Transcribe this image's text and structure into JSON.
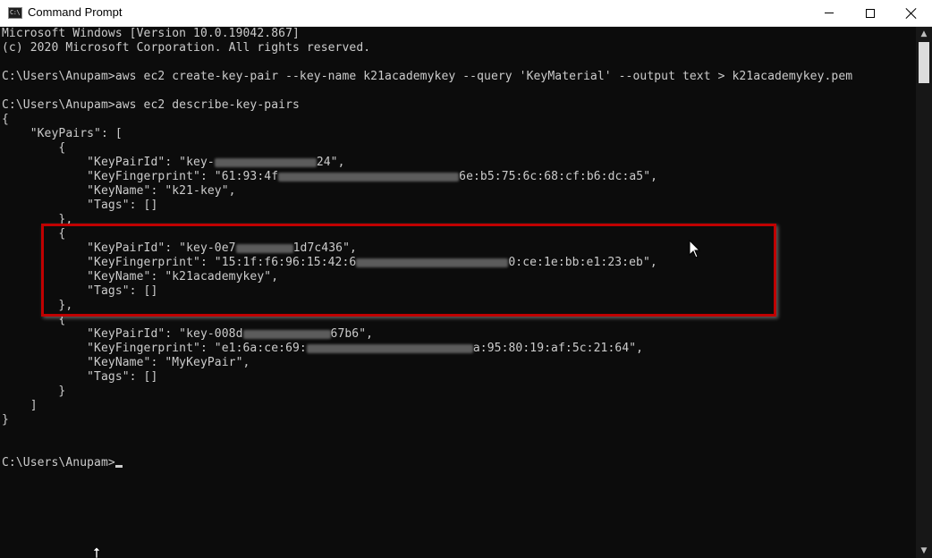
{
  "window": {
    "title": "Command Prompt",
    "icon_label": "C:\\",
    "controls": {
      "minimize": "minimize-icon",
      "maximize": "maximize-icon",
      "close": "close-icon"
    }
  },
  "console": {
    "lines": [
      "Microsoft Windows [Version 10.0.19042.867]",
      "(c) 2020 Microsoft Corporation. All rights reserved.",
      "",
      "C:\\Users\\Anupam>aws ec2 create-key-pair --key-name k21academykey --query 'KeyMaterial' --output text > k21academykey.pem",
      "",
      "C:\\Users\\Anupam>aws ec2 describe-key-pairs",
      "{",
      "    \"KeyPairs\": [",
      "        {",
      "            \"KeyPairId\": \"key-",
      "            \"KeyFingerprint\": \"61:93:4f",
      "            \"KeyName\": \"k21-key\",",
      "            \"Tags\": []",
      "        },",
      "        {",
      "            \"KeyPairId\": \"key-0e7",
      "            \"KeyFingerprint\": \"15:1f:f6:96:15:42:6",
      "            \"KeyName\": \"k21academykey\",",
      "            \"Tags\": []",
      "        },",
      "        {",
      "            \"KeyPairId\": \"key-008d",
      "            \"KeyFingerprint\": \"e1:6a:ce:69:",
      "            \"KeyName\": \"MyKeyPair\",",
      "            \"Tags\": []",
      "        }",
      "    ]",
      "}",
      "",
      "",
      "C:\\Users\\Anupam>"
    ],
    "line_tails": {
      "key1_id": "24\",",
      "key1_fingerprint": "6e:b5:75:6c:68:cf:b6:dc:a5\",",
      "key2_id": "1d7c436\",",
      "key2_fingerprint": "0:ce:1e:bb:e1:23:eb\",",
      "key3_id": "67b6\",",
      "key3_fingerprint": "a:95:80:19:af:5c:21:64\","
    }
  },
  "colors": {
    "background": "#0c0c0c",
    "text": "#cccccc",
    "highlight_border": "#c00000"
  }
}
